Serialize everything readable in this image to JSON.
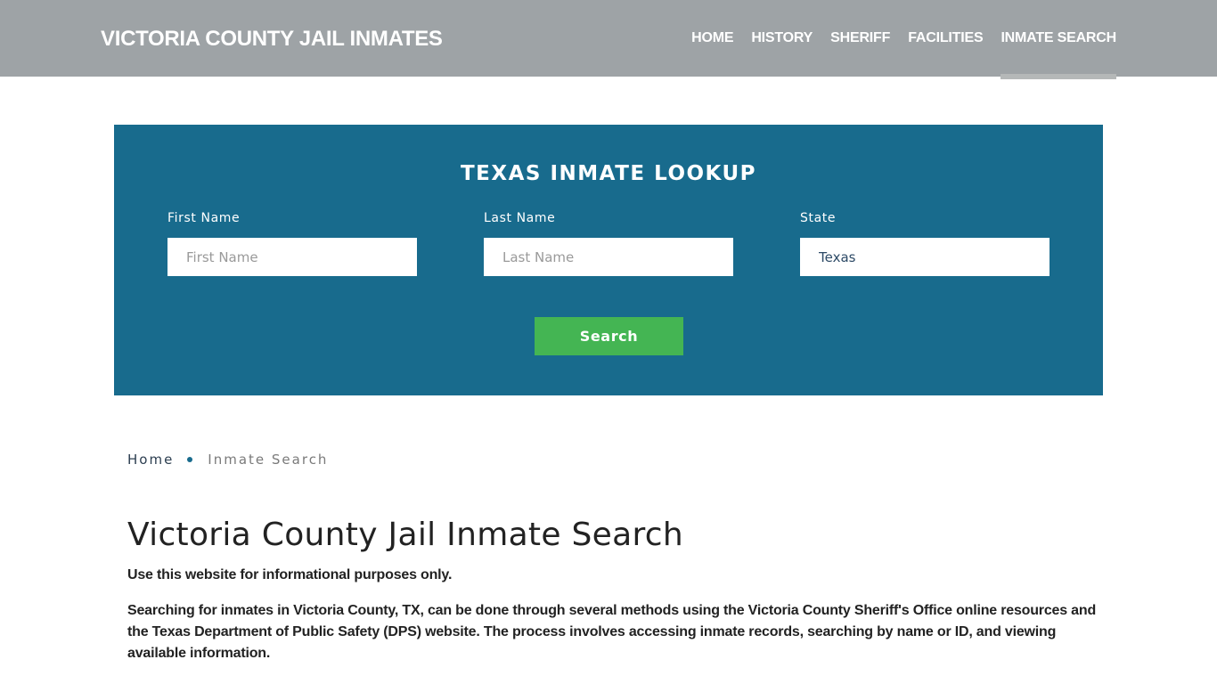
{
  "header": {
    "brand": "VICTORIA COUNTY JAIL INMATES",
    "nav": [
      {
        "label": "HOME",
        "active": false
      },
      {
        "label": "HISTORY",
        "active": false
      },
      {
        "label": "SHERIFF",
        "active": false
      },
      {
        "label": "FACILITIES",
        "active": false
      },
      {
        "label": "INMATE SEARCH",
        "active": true
      }
    ]
  },
  "lookup": {
    "title": "TEXAS INMATE LOOKUP",
    "first_name": {
      "label": "First Name",
      "placeholder": "First Name",
      "value": ""
    },
    "last_name": {
      "label": "Last Name",
      "placeholder": "Last Name",
      "value": ""
    },
    "state": {
      "label": "State",
      "value": "Texas"
    },
    "search_label": "Search"
  },
  "breadcrumb": {
    "home": "Home",
    "current": "Inmate Search"
  },
  "main": {
    "title": "Victoria County Jail Inmate Search",
    "intro": "Use this website for informational purposes only.",
    "paragraph": "Searching for inmates in Victoria County, TX, can be done through several methods using the Victoria County Sheriff's Office online resources and the Texas Department of Public Safety (DPS) website. The process involves accessing inmate records, searching by name or ID, and viewing available information."
  },
  "colors": {
    "header_bg": "#9ea3a6",
    "lookup_bg": "#186b8d",
    "search_button": "#44b553",
    "active_underline": "#b5b8b8"
  }
}
